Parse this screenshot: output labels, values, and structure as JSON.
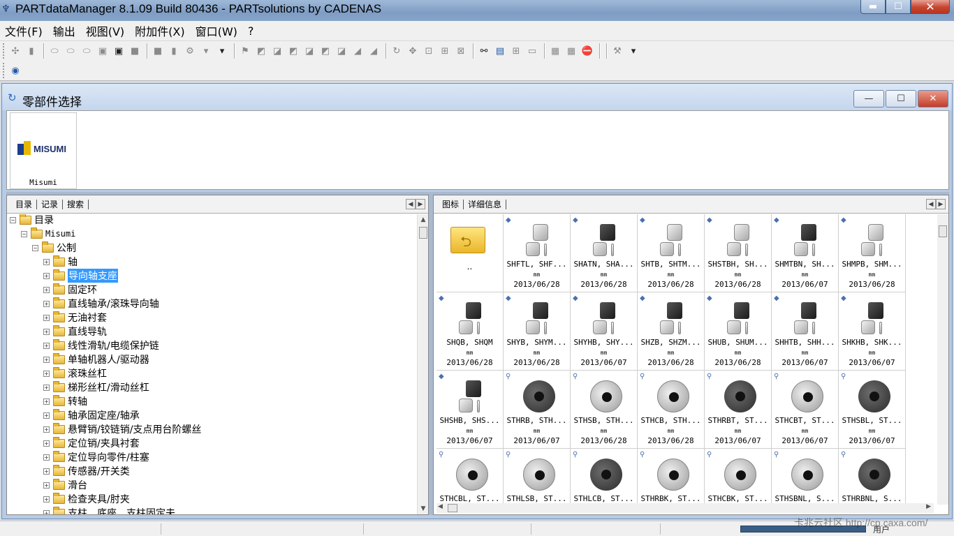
{
  "window": {
    "title": "PARTdataManager 8.1.09 Build 80436 - PARTsolutions by CADENAS",
    "minimize_glyph": "▬",
    "maximize_glyph": "☐",
    "close_glyph": "✕"
  },
  "menubar": {
    "items": [
      "文件(F)",
      "输出",
      "视图(V)",
      "附加件(X)",
      "窗口(W)",
      "?"
    ]
  },
  "subwindow": {
    "title": "零部件选择",
    "icon": "refresh-icon",
    "minimize_glyph": "—",
    "maximize_glyph": "☐",
    "close_glyph": "✕"
  },
  "catalog": {
    "logo_text": "MISUMI",
    "tile_label": "Misumi"
  },
  "left_tabs": [
    "目录",
    "记录",
    "搜索"
  ],
  "right_tabs": [
    "图标",
    "详细信息"
  ],
  "tree": {
    "root": "目录",
    "catalog": "Misumi",
    "group": "公制",
    "items": [
      "轴",
      "导向轴支座",
      "固定环",
      "直线轴承/滚珠导向轴",
      "无油衬套",
      "直线导轨",
      "线性滑轨/电缆保护链",
      "单轴机器人/驱动器",
      "滚珠丝杠",
      "梯形丝杠/滑动丝杠",
      "转轴",
      "轴承固定座/轴承",
      "悬臂销/铰链销/支点用台阶螺丝",
      "定位销/夹具衬套",
      "定位导向零件/柱塞",
      "传感器/开关类",
      "滑台",
      "检查夹具/肘夹",
      "支柱、底座、支柱固定夫"
    ],
    "selected_item": "导向轴支座"
  },
  "grid": {
    "up_label": "..",
    "parts": [
      {
        "name": "SHFTL, SHF...",
        "unit": "mm",
        "date": "2013/06/28"
      },
      {
        "name": "SHATN, SHA...",
        "unit": "mm",
        "date": "2013/06/28"
      },
      {
        "name": "SHTB, SHTM...",
        "unit": "mm",
        "date": "2013/06/28"
      },
      {
        "name": "SHSTBH, SH...",
        "unit": "mm",
        "date": "2013/06/28"
      },
      {
        "name": "SHMTBN, SH...",
        "unit": "mm",
        "date": "2013/06/07"
      },
      {
        "name": "SHMPB, SHM...",
        "unit": "mm",
        "date": "2013/06/28"
      },
      {
        "name": "SHQB, SHQM",
        "unit": "mm",
        "date": "2013/06/28"
      },
      {
        "name": "SHYB, SHYM...",
        "unit": "mm",
        "date": "2013/06/28"
      },
      {
        "name": "SHYHB, SHY...",
        "unit": "mm",
        "date": "2013/06/07"
      },
      {
        "name": "SHZB, SHZM...",
        "unit": "mm",
        "date": "2013/06/28"
      },
      {
        "name": "SHUB, SHUM...",
        "unit": "mm",
        "date": "2013/06/28"
      },
      {
        "name": "SHHTB, SHH...",
        "unit": "mm",
        "date": "2013/06/07"
      },
      {
        "name": "SHKHB, SHK...",
        "unit": "mm",
        "date": "2013/06/07"
      },
      {
        "name": "SHSHB, SHS...",
        "unit": "mm",
        "date": "2013/06/07"
      },
      {
        "name": "STHRB, STH...",
        "unit": "mm",
        "date": "2013/06/07"
      },
      {
        "name": "STHSB, STH...",
        "unit": "mm",
        "date": "2013/06/28"
      },
      {
        "name": "STHCB, STH...",
        "unit": "mm",
        "date": "2013/06/28"
      },
      {
        "name": "STHRBT, ST...",
        "unit": "mm",
        "date": "2013/06/07"
      },
      {
        "name": "STHCBT, ST...",
        "unit": "mm",
        "date": "2013/06/07"
      },
      {
        "name": "STHSBL, ST...",
        "unit": "mm",
        "date": "2013/06/07"
      },
      {
        "name": "STHCBL, ST...",
        "unit": "",
        "date": ""
      },
      {
        "name": "STHLSB, ST...",
        "unit": "",
        "date": ""
      },
      {
        "name": "STHLCB, ST...",
        "unit": "",
        "date": ""
      },
      {
        "name": "STHRBK, ST...",
        "unit": "",
        "date": ""
      },
      {
        "name": "STHCBK, ST...",
        "unit": "",
        "date": ""
      },
      {
        "name": "STHSBNL, S...",
        "unit": "",
        "date": ""
      },
      {
        "name": "STHRBNL, S...",
        "unit": "",
        "date": ""
      }
    ]
  },
  "statusbar": {
    "user_label": "用户"
  },
  "watermark": "卡兆云社区 http://cp.caxa.com/"
}
